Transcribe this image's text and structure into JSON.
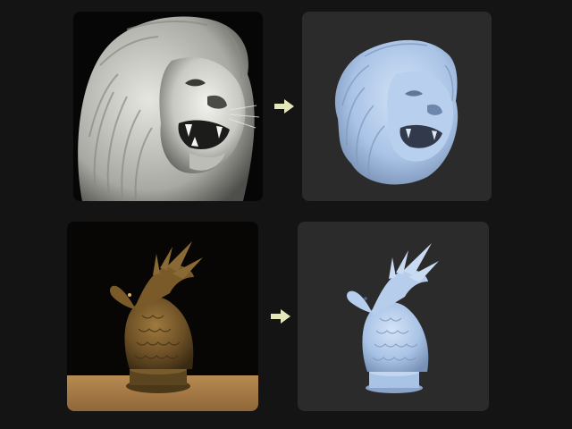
{
  "rows": [
    {
      "input": {
        "subject": "lion-head-sculpture",
        "style": "white marble photo on black background"
      },
      "output": {
        "subject": "lion-head-3d-model",
        "style": "light blue untextured mesh render"
      }
    },
    {
      "input": {
        "subject": "dragon-bust-sculpture",
        "style": "bronze sculpture photo on wooden table"
      },
      "output": {
        "subject": "dragon-bust-3d-model",
        "style": "light blue untextured mesh render"
      }
    }
  ],
  "colors": {
    "background": "#141414",
    "render_panel": "#2b2b2b",
    "mesh_blue": "#a9c3e6",
    "arrow": "#e4e8b8",
    "bronze": "#6b4f25",
    "table": "#a47a45"
  }
}
